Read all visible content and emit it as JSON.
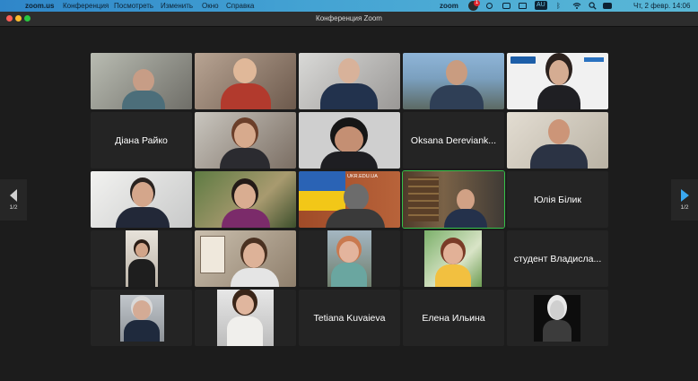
{
  "menubar": {
    "app_name": "zoom.us",
    "items": [
      "Конференция",
      "Посмотреть",
      "Изменить",
      "Окно",
      "Справка"
    ],
    "brand": "zoom",
    "notification_badge": "1",
    "kb_layout": "AU",
    "datetime": "Чт, 2 февр.  14:06"
  },
  "window": {
    "title": "Конференция Zoom"
  },
  "navigation": {
    "prev_page": "1/2",
    "next_page": "1/2"
  },
  "gallery": {
    "name_tiles": {
      "r2c1": "Діана Райко",
      "r2c4": "Oksana Dereviank...",
      "r3c5": "Юлія Білик",
      "r4c5": "студент Владисла...",
      "r5c3": "Tetiana Kuvaieva",
      "r5c4": "Елена Ильина"
    },
    "banner_text": "UKR.EDU.UA"
  },
  "colors": {
    "active_speaker_border": "#35c24a",
    "menubar": "#2f86c9",
    "tile": "#242424"
  }
}
